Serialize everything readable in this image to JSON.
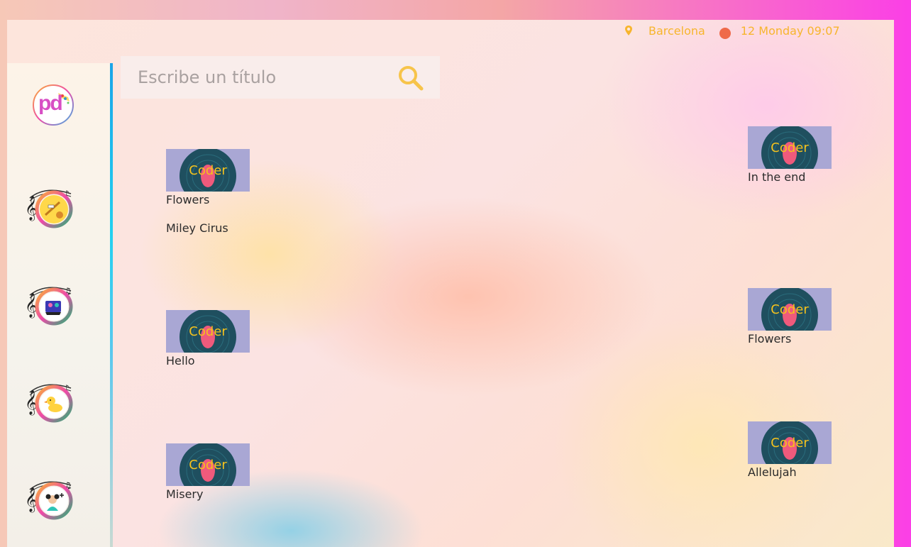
{
  "header": {
    "location_icon": "map-pin-icon",
    "location": "Barcelona",
    "status_color": "#ef6a4a",
    "datetime": "12 Monday 09:07"
  },
  "search": {
    "placeholder": "Escribe un título",
    "icon": "search-icon"
  },
  "sidebar": {
    "logo_text": "pd",
    "items": [
      {
        "icon": "music-instruments-icon"
      },
      {
        "icon": "music-cat-icon"
      },
      {
        "icon": "music-duck-icon"
      },
      {
        "icon": "music-girl-add-icon"
      }
    ]
  },
  "cover_label": "Coder",
  "songs_left": [
    {
      "title": "Flowers",
      "artist": "Miley Cirus"
    },
    {
      "title": "Hello"
    },
    {
      "title": "Misery"
    }
  ],
  "songs_right": [
    {
      "title": "In the end"
    },
    {
      "title": "Flowers"
    },
    {
      "title": "Allelujah"
    }
  ],
  "colors": {
    "accent": "#f7b52d",
    "sidebar_accent": "#1aa4e8",
    "cover_bg": "#a9a7d4"
  }
}
